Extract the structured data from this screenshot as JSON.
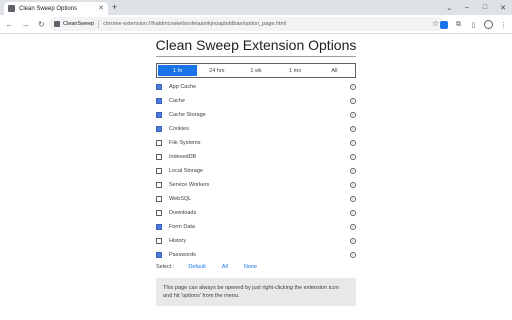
{
  "browser": {
    "tab_title": "Clean Sweep Options",
    "chip_label": "CleanSweep",
    "url": "chrome-extension://lhaldmcnekeboofeiaamkjnoapbddban/option_page.html"
  },
  "page": {
    "title": "Clean Sweep Extension Options",
    "time_ranges": [
      "1 hr",
      "24 hrs",
      "1 wk",
      "1 mo",
      "All"
    ],
    "selected_time_range": "1 hr",
    "options": [
      {
        "label": "App Cache",
        "checked": true
      },
      {
        "label": "Cache",
        "checked": true
      },
      {
        "label": "Cache Storage",
        "checked": true
      },
      {
        "label": "Cookies",
        "checked": true
      },
      {
        "label": "File Systems",
        "checked": false
      },
      {
        "label": "IndexedDB",
        "checked": false
      },
      {
        "label": "Local Storage",
        "checked": false
      },
      {
        "label": "Service Workers",
        "checked": false
      },
      {
        "label": "WebSQL",
        "checked": false
      },
      {
        "label": "Downloads",
        "checked": false
      },
      {
        "label": "Form Data",
        "checked": true
      },
      {
        "label": "History",
        "checked": false
      },
      {
        "label": "Passwords",
        "checked": true
      }
    ],
    "select_label": "Select :",
    "select_links": [
      "Default",
      "All",
      "None"
    ],
    "note": "This page can always be opened by just right-clicking the extension icon and hit 'options' from the menu."
  },
  "colors": {
    "accent": "#1a73e8",
    "checkbox_checked": "#4e7ad8"
  },
  "icons": {
    "back": "back-arrow-icon",
    "forward": "forward-arrow-icon",
    "reload": "reload-icon",
    "star": "star-icon",
    "info": "info-icon"
  }
}
